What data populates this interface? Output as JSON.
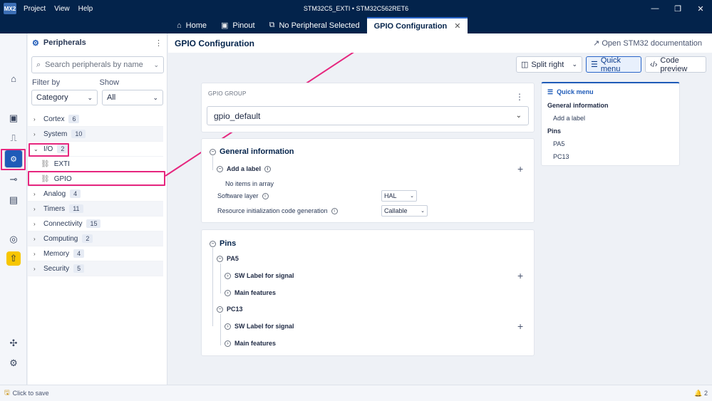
{
  "titlebar": {
    "logo": "MX2",
    "menu": [
      "Project",
      "View",
      "Help"
    ],
    "window_title": "STM32C5_EXTI  •  STM32C562RET6"
  },
  "tabs": [
    {
      "label": "Home",
      "icon": "home-icon"
    },
    {
      "label": "Pinout",
      "icon": "chip-icon"
    },
    {
      "label": "No Peripheral Selected",
      "icon": "peripheral-icon"
    },
    {
      "label": "GPIO Configuration",
      "active": true
    }
  ],
  "peripherals": {
    "title": "Peripherals",
    "search_placeholder": "Search peripherals by name",
    "filter_by_label": "Filter by",
    "show_label": "Show",
    "filter_value": "Category",
    "show_value": "All",
    "items": [
      {
        "label": "Cortex",
        "count": "6"
      },
      {
        "label": "System",
        "count": "10"
      },
      {
        "label": "I/O",
        "count": "2",
        "expanded": true
      },
      {
        "label": "EXTI",
        "child": true
      },
      {
        "label": "GPIO",
        "child": true
      },
      {
        "label": "Analog",
        "count": "4"
      },
      {
        "label": "Timers",
        "count": "11"
      },
      {
        "label": "Connectivity",
        "count": "15"
      },
      {
        "label": "Computing",
        "count": "2"
      },
      {
        "label": "Memory",
        "count": "4"
      },
      {
        "label": "Security",
        "count": "5"
      }
    ]
  },
  "main": {
    "title": "GPIO Configuration",
    "doc_link": "Open STM32 documentation",
    "toolbar": {
      "split": "Split right",
      "quick_menu": "Quick menu",
      "code_preview": "Code preview"
    },
    "group": {
      "label": "GPIO GROUP",
      "value": "gpio_default"
    },
    "general": {
      "title": "General information",
      "add_label": "Add a label",
      "empty_text": "No items in array",
      "software_layer_label": "Software layer",
      "software_layer_value": "HAL",
      "resource_label": "Resource initialization code generation",
      "resource_value": "Callable"
    },
    "pins": {
      "title": "Pins",
      "items": [
        {
          "name": "PA5",
          "sw_label": "SW Label for signal",
          "features": "Main features"
        },
        {
          "name": "PC13",
          "sw_label": "SW Label for signal",
          "features": "Main features"
        }
      ]
    }
  },
  "quick_menu": {
    "title": "Quick menu",
    "general": "General information",
    "add_label": "Add a label",
    "pins": "Pins",
    "pin_items": [
      "PA5",
      "PC13"
    ]
  },
  "status": {
    "save": "Click to save",
    "notifications": "2"
  },
  "colors": {
    "navy": "#03234b",
    "accent": "#1f5bb8",
    "highlight": "#e6267e",
    "warning": "#f7c600"
  }
}
